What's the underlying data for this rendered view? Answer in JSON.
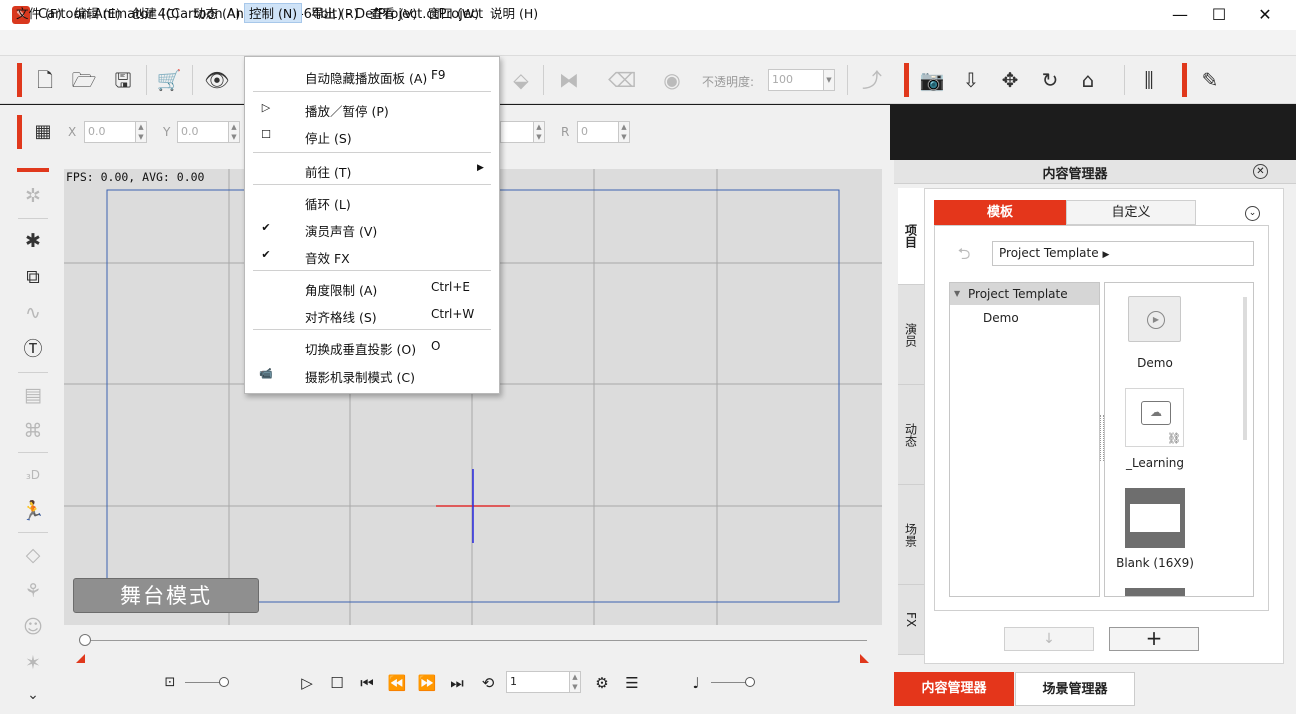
{
  "window": {
    "title": "Cartoon Animator 4(Cartoon Animator 4-64bit) - DefProject.ctProject",
    "minimize": "—",
    "maximize": "☐",
    "close": "✕"
  },
  "menubar": [
    {
      "label": "文件 (F)"
    },
    {
      "label": "编辑 (E)"
    },
    {
      "label": "创建 (C)"
    },
    {
      "label": "动态 (A)"
    },
    {
      "label": "控制 (N)"
    },
    {
      "label": "导出 (R)"
    },
    {
      "label": "查看 (V)"
    },
    {
      "label": "窗口 (W)"
    },
    {
      "label": "说明 (H)"
    }
  ],
  "toolbar": {
    "opacity_label": "不透明度:",
    "opacity_value": "100"
  },
  "transform": {
    "x_label": "X",
    "x_value": "0.0",
    "y_label": "Y",
    "y_value": "0.0",
    "extra_value": "",
    "r_label": "R",
    "r_value": "0"
  },
  "context_menu": [
    {
      "label": "自动隐藏播放面板 (A)",
      "key": "F9",
      "mark": ""
    },
    {
      "label": "播放／暂停 (P)",
      "key": "",
      "mark": "▷"
    },
    {
      "label": "停止 (S)",
      "key": "",
      "mark": "☐"
    },
    {
      "label": "前往 (T)",
      "key": "",
      "mark": ""
    },
    {
      "label": "循环 (L)",
      "key": "",
      "mark": ""
    },
    {
      "label": "演员声音 (V)",
      "key": "",
      "mark": "✔"
    },
    {
      "label": "音效 FX",
      "key": "",
      "mark": "✔"
    },
    {
      "label": "角度限制 (A)",
      "key": "Ctrl+E",
      "mark": ""
    },
    {
      "label": "对齐格线 (S)",
      "key": "Ctrl+W",
      "mark": ""
    },
    {
      "label": "切换成垂直投影 (O)",
      "key": "O",
      "mark": ""
    },
    {
      "label": "摄影机录制模式 (C)",
      "key": "",
      "mark": "📹"
    }
  ],
  "stage": {
    "fps": "FPS: 0.00, AVG: 0.00",
    "mode": "舞台模式"
  },
  "timeline": {
    "frame_value": "1"
  },
  "content_manager": {
    "title": "内容管理器",
    "side_tabs": [
      "项目",
      "演员",
      "动态",
      "场景",
      "FX"
    ],
    "tab_template": "模板",
    "tab_custom": "自定义",
    "breadcrumb": "Project Template",
    "tree_root": "Project Template",
    "tree_child": "Demo",
    "thumbs": [
      {
        "label": "Demo"
      },
      {
        "label": "_Learning"
      },
      {
        "label": "Blank (16X9)"
      }
    ],
    "add_button": "+",
    "down_button": "↓"
  },
  "bottom_tabs": {
    "content_manager": "内容管理器",
    "scene_manager": "场景管理器"
  },
  "colors": {
    "accent": "#e4361b"
  }
}
